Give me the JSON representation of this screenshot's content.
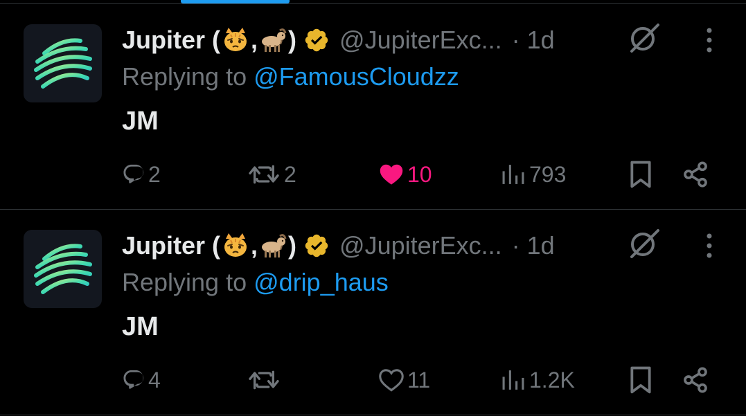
{
  "colors": {
    "background": "#000000",
    "primary_text": "#e7e9ea",
    "secondary_text": "#71767b",
    "accent_blue": "#1d9bf0",
    "like_pink": "#f91880",
    "verified_gold": "#e8b62c",
    "divider": "#2f3336"
  },
  "tweets": [
    {
      "name": "Jupiter (",
      "name_sep": ",",
      "name_close": ")",
      "handle": "@JupiterExc...",
      "time": "· 1d",
      "reply_prefix": "Replying to",
      "reply_mention": "@FamousCloudzz",
      "text": "JM",
      "replies": "2",
      "reposts": "2",
      "likes": "10",
      "liked": true,
      "views": "793"
    },
    {
      "name": "Jupiter (",
      "name_sep": ",",
      "name_close": ")",
      "handle": "@JupiterExc...",
      "time": "· 1d",
      "reply_prefix": "Replying to",
      "reply_mention": "@drip_haus",
      "text": "JM",
      "replies": "4",
      "reposts": "",
      "likes": "11",
      "liked": false,
      "views": "1.2K"
    }
  ],
  "icons": {
    "avatar": "jupiter-logo",
    "emoji_1": "cat-face-emoji",
    "emoji_2": "goat-emoji",
    "verified": "verified-badge-gold",
    "grok": "grok-icon",
    "more": "more-vertical-icon",
    "reply": "reply-icon",
    "repost": "repost-icon",
    "like": "heart-icon",
    "views": "views-icon",
    "bookmark": "bookmark-icon",
    "share": "share-icon"
  }
}
